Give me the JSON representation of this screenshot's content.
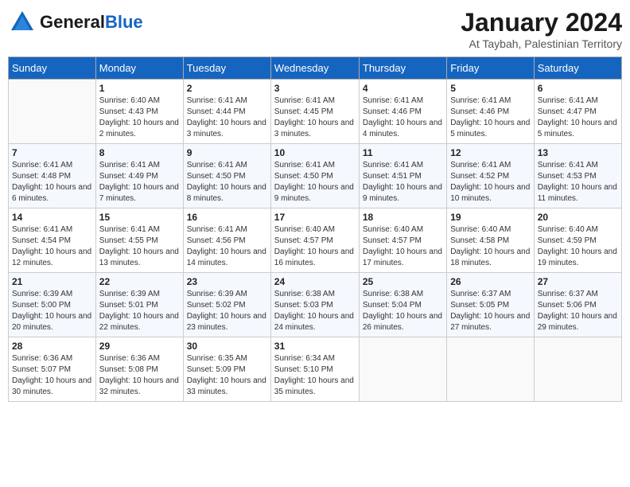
{
  "header": {
    "logo_general": "General",
    "logo_blue": "Blue",
    "month_title": "January 2024",
    "subtitle": "At Taybah, Palestinian Territory"
  },
  "columns": [
    "Sunday",
    "Monday",
    "Tuesday",
    "Wednesday",
    "Thursday",
    "Friday",
    "Saturday"
  ],
  "weeks": [
    {
      "days": [
        {
          "number": "",
          "sunrise": "",
          "sunset": "",
          "daylight": ""
        },
        {
          "number": "1",
          "sunrise": "Sunrise: 6:40 AM",
          "sunset": "Sunset: 4:43 PM",
          "daylight": "Daylight: 10 hours and 2 minutes."
        },
        {
          "number": "2",
          "sunrise": "Sunrise: 6:41 AM",
          "sunset": "Sunset: 4:44 PM",
          "daylight": "Daylight: 10 hours and 3 minutes."
        },
        {
          "number": "3",
          "sunrise": "Sunrise: 6:41 AM",
          "sunset": "Sunset: 4:45 PM",
          "daylight": "Daylight: 10 hours and 3 minutes."
        },
        {
          "number": "4",
          "sunrise": "Sunrise: 6:41 AM",
          "sunset": "Sunset: 4:46 PM",
          "daylight": "Daylight: 10 hours and 4 minutes."
        },
        {
          "number": "5",
          "sunrise": "Sunrise: 6:41 AM",
          "sunset": "Sunset: 4:46 PM",
          "daylight": "Daylight: 10 hours and 5 minutes."
        },
        {
          "number": "6",
          "sunrise": "Sunrise: 6:41 AM",
          "sunset": "Sunset: 4:47 PM",
          "daylight": "Daylight: 10 hours and 5 minutes."
        }
      ]
    },
    {
      "days": [
        {
          "number": "7",
          "sunrise": "Sunrise: 6:41 AM",
          "sunset": "Sunset: 4:48 PM",
          "daylight": "Daylight: 10 hours and 6 minutes."
        },
        {
          "number": "8",
          "sunrise": "Sunrise: 6:41 AM",
          "sunset": "Sunset: 4:49 PM",
          "daylight": "Daylight: 10 hours and 7 minutes."
        },
        {
          "number": "9",
          "sunrise": "Sunrise: 6:41 AM",
          "sunset": "Sunset: 4:50 PM",
          "daylight": "Daylight: 10 hours and 8 minutes."
        },
        {
          "number": "10",
          "sunrise": "Sunrise: 6:41 AM",
          "sunset": "Sunset: 4:50 PM",
          "daylight": "Daylight: 10 hours and 9 minutes."
        },
        {
          "number": "11",
          "sunrise": "Sunrise: 6:41 AM",
          "sunset": "Sunset: 4:51 PM",
          "daylight": "Daylight: 10 hours and 9 minutes."
        },
        {
          "number": "12",
          "sunrise": "Sunrise: 6:41 AM",
          "sunset": "Sunset: 4:52 PM",
          "daylight": "Daylight: 10 hours and 10 minutes."
        },
        {
          "number": "13",
          "sunrise": "Sunrise: 6:41 AM",
          "sunset": "Sunset: 4:53 PM",
          "daylight": "Daylight: 10 hours and 11 minutes."
        }
      ]
    },
    {
      "days": [
        {
          "number": "14",
          "sunrise": "Sunrise: 6:41 AM",
          "sunset": "Sunset: 4:54 PM",
          "daylight": "Daylight: 10 hours and 12 minutes."
        },
        {
          "number": "15",
          "sunrise": "Sunrise: 6:41 AM",
          "sunset": "Sunset: 4:55 PM",
          "daylight": "Daylight: 10 hours and 13 minutes."
        },
        {
          "number": "16",
          "sunrise": "Sunrise: 6:41 AM",
          "sunset": "Sunset: 4:56 PM",
          "daylight": "Daylight: 10 hours and 14 minutes."
        },
        {
          "number": "17",
          "sunrise": "Sunrise: 6:40 AM",
          "sunset": "Sunset: 4:57 PM",
          "daylight": "Daylight: 10 hours and 16 minutes."
        },
        {
          "number": "18",
          "sunrise": "Sunrise: 6:40 AM",
          "sunset": "Sunset: 4:57 PM",
          "daylight": "Daylight: 10 hours and 17 minutes."
        },
        {
          "number": "19",
          "sunrise": "Sunrise: 6:40 AM",
          "sunset": "Sunset: 4:58 PM",
          "daylight": "Daylight: 10 hours and 18 minutes."
        },
        {
          "number": "20",
          "sunrise": "Sunrise: 6:40 AM",
          "sunset": "Sunset: 4:59 PM",
          "daylight": "Daylight: 10 hours and 19 minutes."
        }
      ]
    },
    {
      "days": [
        {
          "number": "21",
          "sunrise": "Sunrise: 6:39 AM",
          "sunset": "Sunset: 5:00 PM",
          "daylight": "Daylight: 10 hours and 20 minutes."
        },
        {
          "number": "22",
          "sunrise": "Sunrise: 6:39 AM",
          "sunset": "Sunset: 5:01 PM",
          "daylight": "Daylight: 10 hours and 22 minutes."
        },
        {
          "number": "23",
          "sunrise": "Sunrise: 6:39 AM",
          "sunset": "Sunset: 5:02 PM",
          "daylight": "Daylight: 10 hours and 23 minutes."
        },
        {
          "number": "24",
          "sunrise": "Sunrise: 6:38 AM",
          "sunset": "Sunset: 5:03 PM",
          "daylight": "Daylight: 10 hours and 24 minutes."
        },
        {
          "number": "25",
          "sunrise": "Sunrise: 6:38 AM",
          "sunset": "Sunset: 5:04 PM",
          "daylight": "Daylight: 10 hours and 26 minutes."
        },
        {
          "number": "26",
          "sunrise": "Sunrise: 6:37 AM",
          "sunset": "Sunset: 5:05 PM",
          "daylight": "Daylight: 10 hours and 27 minutes."
        },
        {
          "number": "27",
          "sunrise": "Sunrise: 6:37 AM",
          "sunset": "Sunset: 5:06 PM",
          "daylight": "Daylight: 10 hours and 29 minutes."
        }
      ]
    },
    {
      "days": [
        {
          "number": "28",
          "sunrise": "Sunrise: 6:36 AM",
          "sunset": "Sunset: 5:07 PM",
          "daylight": "Daylight: 10 hours and 30 minutes."
        },
        {
          "number": "29",
          "sunrise": "Sunrise: 6:36 AM",
          "sunset": "Sunset: 5:08 PM",
          "daylight": "Daylight: 10 hours and 32 minutes."
        },
        {
          "number": "30",
          "sunrise": "Sunrise: 6:35 AM",
          "sunset": "Sunset: 5:09 PM",
          "daylight": "Daylight: 10 hours and 33 minutes."
        },
        {
          "number": "31",
          "sunrise": "Sunrise: 6:34 AM",
          "sunset": "Sunset: 5:10 PM",
          "daylight": "Daylight: 10 hours and 35 minutes."
        },
        {
          "number": "",
          "sunrise": "",
          "sunset": "",
          "daylight": ""
        },
        {
          "number": "",
          "sunrise": "",
          "sunset": "",
          "daylight": ""
        },
        {
          "number": "",
          "sunrise": "",
          "sunset": "",
          "daylight": ""
        }
      ]
    }
  ]
}
